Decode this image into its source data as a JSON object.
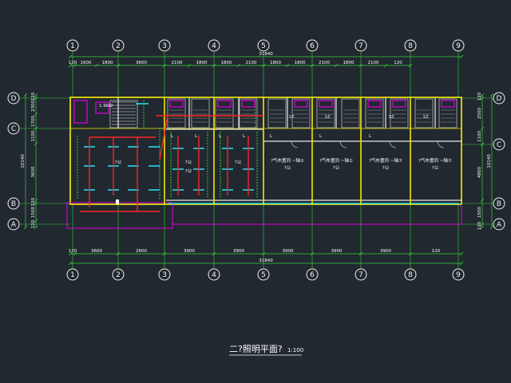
{
  "drawing": {
    "title": "二?照明平面?",
    "scale": "1:100",
    "axes_x": [
      "1",
      "2",
      "3",
      "4",
      "5",
      "6",
      "7",
      "8",
      "9"
    ],
    "axes_y_left": [
      "D",
      "C",
      "B",
      "A"
    ],
    "axes_y_right": [
      "D",
      "C",
      "B",
      "A"
    ],
    "total_top": "31840",
    "total_bottom": "31840",
    "dims_top": [
      "120",
      "1600",
      "1800",
      "3600",
      "2100",
      "1800",
      "1800",
      "2100",
      "1800",
      "1800",
      "2100",
      "1800",
      "2100",
      "120"
    ],
    "dims_bottom": [
      "120",
      "3600",
      "2600",
      "3900",
      "3900",
      "3900",
      "3900",
      "3900",
      "120"
    ],
    "dims_left": [
      "120",
      "2300",
      "1700",
      "1100",
      "3600",
      "120",
      "1500",
      "120"
    ],
    "dims_left_total": "10140",
    "dims_right": [
      "120",
      "2500",
      "1100",
      "4800",
      "1500",
      "120"
    ],
    "dims_right_total": "10140",
    "rooms": [
      {
        "label1": "?公",
        "label2": ""
      },
      {
        "label1": "?公",
        "label2": ""
      },
      {
        "label1": "?公",
        "label2": ""
      },
      {
        "label1": "?公",
        "label2": ""
      },
      {
        "label1": "?气布置同 ~轴①",
        "label2": "?公"
      },
      {
        "label1": "?气布置同 ~轴①",
        "label2": "?公"
      },
      {
        "label1": "?气布置同 ~轴⑦",
        "label2": "?公"
      },
      {
        "label1": "?气布置同 ~轴⑦",
        "label2": "?公"
      }
    ],
    "toilet_labels": [
      "1Z",
      "1Z",
      "1Z",
      "1Z"
    ],
    "misc_labels": [
      "1.9kW",
      "L",
      "L",
      "L",
      "L",
      "L",
      "L",
      "L"
    ]
  }
}
